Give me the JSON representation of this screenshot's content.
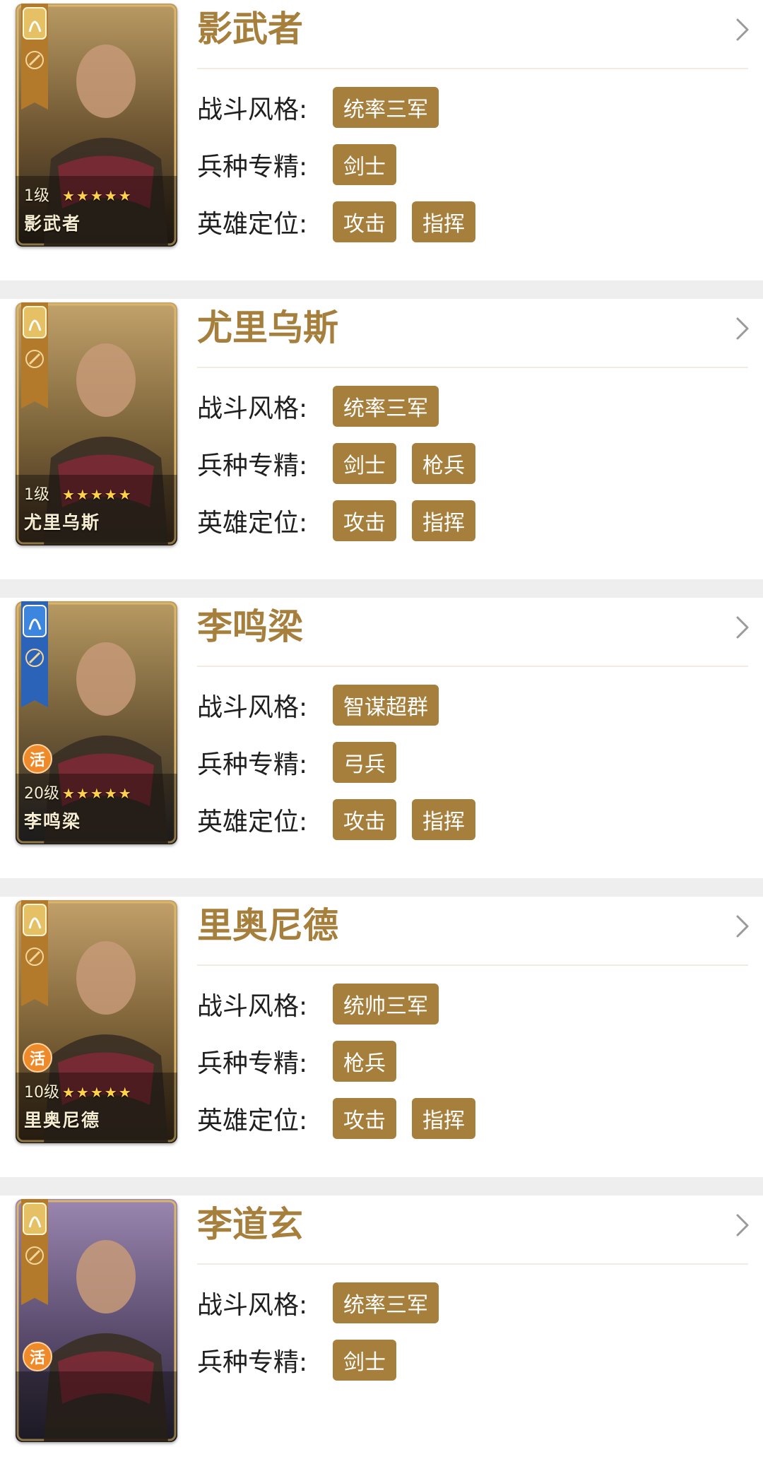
{
  "labels": {
    "style": "战斗风格:",
    "troop": "兵种专精:",
    "role": "英雄定位:"
  },
  "colors": {
    "accent": "#a67f3c",
    "badge_orange": "#ef8a2a",
    "page_bg": "#eeeeee"
  },
  "heroes": [
    {
      "name": "影武者",
      "level": "1级",
      "stars": "★★★★★",
      "badge": "",
      "card_name": "影武者",
      "emblem": "gold-lion-emblem",
      "style_tags": [
        "统率三军"
      ],
      "troop_tags": [
        "剑士"
      ],
      "role_tags": [
        "攻击",
        "指挥"
      ]
    },
    {
      "name": "尤里乌斯",
      "level": "1级",
      "stars": "★★★★★",
      "badge": "",
      "card_name": "尤里乌斯",
      "emblem": "gold-lion-emblem",
      "style_tags": [
        "统率三军"
      ],
      "troop_tags": [
        "剑士",
        "枪兵"
      ],
      "role_tags": [
        "攻击",
        "指挥"
      ]
    },
    {
      "name": "李鸣梁",
      "level": "20级",
      "stars": "★★★★★",
      "badge": "活",
      "card_name": "李鸣梁",
      "emblem": "blue-dragon-emblem",
      "style_tags": [
        "智谋超群"
      ],
      "troop_tags": [
        "弓兵"
      ],
      "role_tags": [
        "攻击",
        "指挥"
      ]
    },
    {
      "name": "里奥尼德",
      "level": "10级",
      "stars": "★★★★★",
      "badge": "活",
      "card_name": "里奥尼德",
      "emblem": "gold-lion-emblem",
      "style_tags": [
        "统帅三军"
      ],
      "troop_tags": [
        "枪兵"
      ],
      "role_tags": [
        "攻击",
        "指挥"
      ]
    },
    {
      "name": "李道玄",
      "level": "",
      "stars": "",
      "badge": "活",
      "card_name": "",
      "emblem": "gold-lion-emblem",
      "style_tags": [
        "统率三军"
      ],
      "troop_tags": [
        "剑士"
      ],
      "role_tags": []
    }
  ]
}
